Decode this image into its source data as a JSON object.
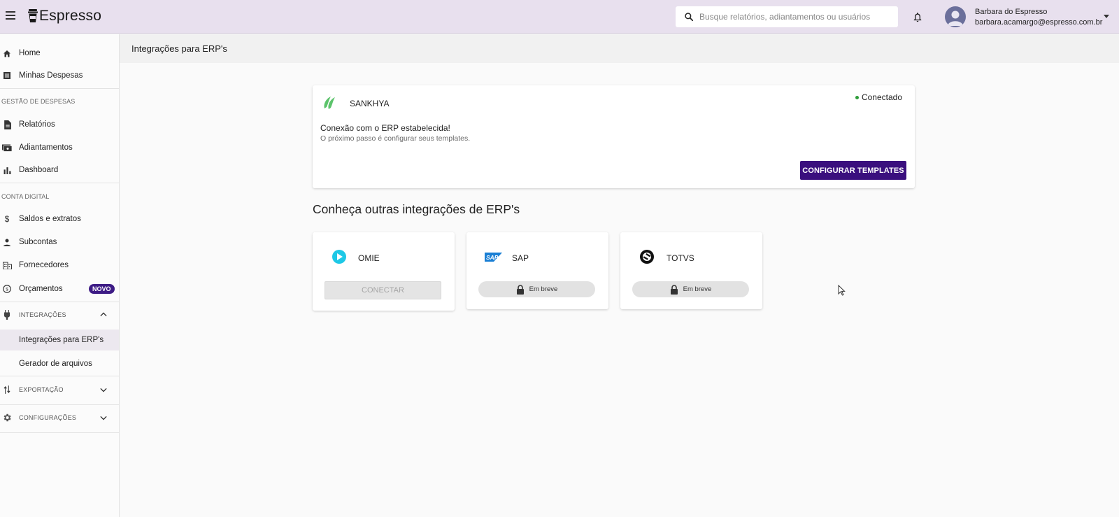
{
  "app": {
    "name": "Espresso"
  },
  "search": {
    "placeholder": "Busque relatórios, adiantamentos ou usuários"
  },
  "user": {
    "name": "Barbara do Espresso",
    "email": "barbara.acamargo@espresso.com.br"
  },
  "sidebar": {
    "home": "Home",
    "minhas_despesas": "Minhas Despesas",
    "section_gestao": "GESTÃO DE DESPESAS",
    "relatorios": "Relatórios",
    "adiantamentos": "Adiantamentos",
    "dashboard": "Dashboard",
    "section_conta": "CONTA DIGITAL",
    "saldos": "Saldos e extratos",
    "subcontas": "Subcontas",
    "fornecedores": "Fornecedores",
    "orcamentos": "Orçamentos",
    "badge_novo": "NOVO",
    "integracoes": "INTEGRAÇÕES",
    "integracoes_erp": "Integrações para ERP's",
    "gerador": "Gerador de arquivos",
    "exportacao": "EXPORTAÇÃO",
    "configuracoes": "CONFIGURAÇÕES"
  },
  "page": {
    "title": "Integrações para ERP's"
  },
  "connected": {
    "name": "SANKHYA",
    "status": "Conectado",
    "message": "Conexão com o ERP estabelecida!",
    "sub": "O próximo passo é configurar seus templates.",
    "button": "CONFIGURAR TEMPLATES"
  },
  "others": {
    "title": "Conheça outras integrações de ERP's",
    "items": [
      {
        "name": "OMIE",
        "button": "CONECTAR"
      },
      {
        "name": "SAP",
        "button": "Em breve"
      },
      {
        "name": "TOTVS",
        "button": "Em breve"
      }
    ]
  },
  "colors": {
    "topbar": "#e8e0ee",
    "primary": "#3a0f7e",
    "status": "#2e9d3a"
  }
}
